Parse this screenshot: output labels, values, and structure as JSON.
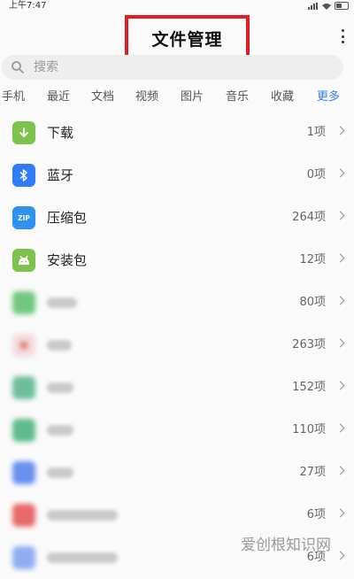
{
  "status": {
    "time": "上午7:47"
  },
  "header": {
    "title": "文件管理"
  },
  "search": {
    "placeholder": "搜索"
  },
  "tabs": [
    "手机",
    "最近",
    "文档",
    "视频",
    "图片",
    "音乐",
    "收藏",
    "更多"
  ],
  "items": [
    {
      "label": "下载",
      "count": "1项",
      "icon": "download-icon",
      "color": "#7cc24c"
    },
    {
      "label": "蓝牙",
      "count": "0项",
      "icon": "bluetooth-icon",
      "color": "#2f7df6"
    },
    {
      "label": "压缩包",
      "count": "264项",
      "icon": "zip-icon",
      "color": "#2f91f0"
    },
    {
      "label": "安装包",
      "count": "12项",
      "icon": "android-icon",
      "color": "#7cc24c"
    }
  ],
  "blurred_items": [
    {
      "count": "80项",
      "color": "#5bbf6a"
    },
    {
      "count": "263项",
      "color": "#e25757"
    },
    {
      "count": "152项",
      "color": "#55b58a"
    },
    {
      "count": "110项",
      "color": "#45b07a"
    },
    {
      "count": "27项",
      "color": "#4f7ef0"
    },
    {
      "count": "6项",
      "color": "#e65050"
    },
    {
      "count": "6项",
      "color": "#7ea0f2"
    }
  ],
  "watermark": "爱创根知识网"
}
